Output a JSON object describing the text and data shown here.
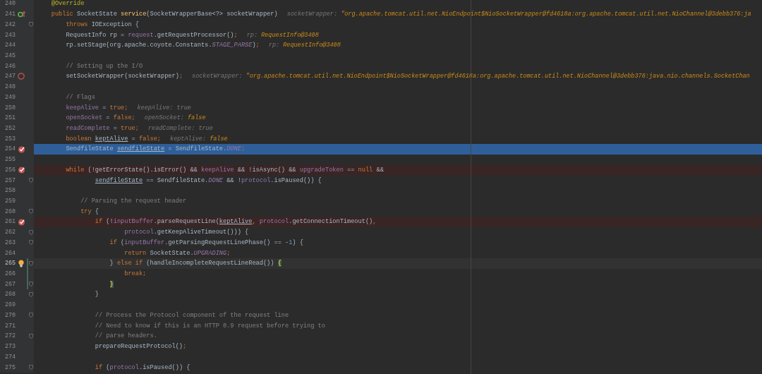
{
  "lines": [
    {
      "number": "240",
      "execution_point": false,
      "caret": false,
      "fold": false,
      "changed": false,
      "tokens": [
        {
          "text": "    @Override",
          "kind": "annotation"
        }
      ]
    },
    {
      "number": "241",
      "execution_point": false,
      "caret": false,
      "fold": false,
      "changed": false,
      "kind": "override",
      "tokens": [
        {
          "text": "    public",
          "kind": "keyword"
        },
        {
          "text": " SocketState ",
          "kind": "plain"
        },
        {
          "text": "service",
          "kind": "method"
        },
        {
          "text": "(SocketWrapperBase<?> socketWrapper)",
          "kind": "plain"
        }
      ],
      "hint": {
        "label": "socketWrapper: ",
        "value": "\"org.apache.tomcat.util.net.NioEndpoint$NioSocketWrapper@fd4618a:org.apache.tomcat.util.net.NioChannel@3debb376:ja",
        "kind": "emphasis"
      }
    },
    {
      "number": "242",
      "execution_point": false,
      "caret": false,
      "fold": true,
      "changed": false,
      "tokens": [
        {
          "text": "        throws",
          "kind": "keyword"
        },
        {
          "text": " IOException {",
          "kind": "plain"
        }
      ]
    },
    {
      "number": "243",
      "execution_point": false,
      "caret": false,
      "fold": false,
      "changed": false,
      "tokens": [
        {
          "text": "        RequestInfo rp = ",
          "kind": "plain"
        },
        {
          "text": "request",
          "kind": "field"
        },
        {
          "text": ".getRequestProcessor()",
          "kind": "plain"
        },
        {
          "text": ";",
          "kind": "keyword"
        }
      ],
      "hint": {
        "label": "rp: ",
        "value": "RequestInfo@3408",
        "kind": "emphasis"
      }
    },
    {
      "number": "244",
      "execution_point": false,
      "caret": false,
      "fold": false,
      "changed": false,
      "tokens": [
        {
          "text": "        rp.setStage(org.apache.coyote.Constants.",
          "kind": "plain"
        },
        {
          "text": "STAGE_PARSE",
          "kind": "static"
        },
        {
          "text": ")",
          "kind": "plain"
        },
        {
          "text": ";",
          "kind": "keyword"
        }
      ],
      "hint": {
        "label": "rp: ",
        "value": "RequestInfo@3408",
        "kind": "emphasis"
      }
    },
    {
      "number": "245",
      "execution_point": false,
      "caret": false,
      "fold": false,
      "changed": false
    },
    {
      "number": "246",
      "execution_point": false,
      "caret": false,
      "fold": false,
      "changed": false,
      "tokens": [
        {
          "text": "        // Setting up the I/O",
          "kind": "comment"
        }
      ]
    },
    {
      "number": "247",
      "execution_point": false,
      "caret": false,
      "fold": false,
      "changed": false,
      "kind": "disabled-breakpoint",
      "tokens": [
        {
          "text": "        setSocketWrapper(socketWrapper)",
          "kind": "plain"
        },
        {
          "text": ";",
          "kind": "keyword"
        }
      ],
      "hint": {
        "label": "socketWrapper: ",
        "value": "\"org.apache.tomcat.util.net.NioEndpoint$NioSocketWrapper@fd4618a:org.apache.tomcat.util.net.NioChannel@3debb376:java.nio.channels.SocketChan",
        "kind": "emphasis"
      }
    },
    {
      "number": "248",
      "execution_point": false,
      "caret": false,
      "fold": false,
      "changed": false
    },
    {
      "number": "249",
      "execution_point": false,
      "caret": false,
      "fold": false,
      "changed": false,
      "tokens": [
        {
          "text": "        // Flags",
          "kind": "comment"
        }
      ]
    },
    {
      "number": "250",
      "execution_point": false,
      "caret": false,
      "fold": false,
      "changed": false,
      "tokens": [
        {
          "text": "        keepAlive",
          "kind": "field"
        },
        {
          "text": " = ",
          "kind": "plain"
        },
        {
          "text": "true;",
          "kind": "keyword"
        }
      ],
      "hint": {
        "label": "keepAlive: ",
        "value": "true",
        "kind": "plain"
      }
    },
    {
      "number": "251",
      "execution_point": false,
      "caret": false,
      "fold": false,
      "changed": false,
      "tokens": [
        {
          "text": "        openSocket",
          "kind": "field"
        },
        {
          "text": " = ",
          "kind": "plain"
        },
        {
          "text": "false;",
          "kind": "keyword"
        }
      ],
      "hint": {
        "label": "openSocket: ",
        "value": "false",
        "kind": "emphasis"
      }
    },
    {
      "number": "252",
      "execution_point": false,
      "caret": false,
      "fold": false,
      "changed": false,
      "tokens": [
        {
          "text": "        readComplete",
          "kind": "field"
        },
        {
          "text": " = ",
          "kind": "plain"
        },
        {
          "text": "true;",
          "kind": "keyword"
        }
      ],
      "hint": {
        "label": "readComplete: ",
        "value": "true",
        "kind": "plain"
      }
    },
    {
      "number": "253",
      "execution_point": false,
      "caret": false,
      "fold": false,
      "changed": false,
      "tokens": [
        {
          "text": "        boolean ",
          "kind": "keyword"
        },
        {
          "text": "keptAlive",
          "kind": "underlined"
        },
        {
          "text": " = ",
          "kind": "plain"
        },
        {
          "text": "false;",
          "kind": "keyword"
        }
      ],
      "hint": {
        "label": "keptAlive: ",
        "value": "false",
        "kind": "emphasis"
      }
    },
    {
      "number": "254",
      "execution_point": true,
      "caret": false,
      "fold": false,
      "changed": false,
      "kind": "breakpoint",
      "tokens": [
        {
          "text": "        SendfileState ",
          "kind": "plain"
        },
        {
          "text": "sendfileState",
          "kind": "underlined"
        },
        {
          "text": " = SendfileState.",
          "kind": "plain"
        },
        {
          "text": "DONE",
          "kind": "static"
        },
        {
          "text": ";",
          "kind": "keyword"
        }
      ]
    },
    {
      "number": "255",
      "execution_point": false,
      "caret": false,
      "fold": false,
      "changed": false
    },
    {
      "number": "256",
      "execution_point": false,
      "caret": false,
      "fold": false,
      "changed": false,
      "kind": "breakpoint",
      "tokens": [
        {
          "text": "        while",
          "kind": "keyword"
        },
        {
          "text": " (!getErrorState().isError() && ",
          "kind": "plain"
        },
        {
          "text": "keepAlive",
          "kind": "field"
        },
        {
          "text": " && !isAsync() && ",
          "kind": "plain"
        },
        {
          "text": "upgradeToken",
          "kind": "field"
        },
        {
          "text": " == ",
          "kind": "plain"
        },
        {
          "text": "null",
          "kind": "keyword"
        },
        {
          "text": " &&",
          "kind": "plain"
        }
      ]
    },
    {
      "number": "257",
      "execution_point": false,
      "caret": false,
      "fold": true,
      "changed": false,
      "tokens": [
        {
          "text": "                sendfileState",
          "kind": "underlined"
        },
        {
          "text": " == SendfileState.",
          "kind": "plain"
        },
        {
          "text": "DONE",
          "kind": "static"
        },
        {
          "text": " && !",
          "kind": "plain"
        },
        {
          "text": "protocol",
          "kind": "field"
        },
        {
          "text": ".isPaused()) {",
          "kind": "plain"
        }
      ]
    },
    {
      "number": "258",
      "execution_point": false,
      "caret": false,
      "fold": false,
      "changed": false
    },
    {
      "number": "259",
      "execution_point": false,
      "caret": false,
      "fold": false,
      "changed": false,
      "tokens": [
        {
          "text": "            // Parsing the request header",
          "kind": "comment"
        }
      ]
    },
    {
      "number": "260",
      "execution_point": false,
      "caret": false,
      "fold": true,
      "changed": false,
      "tokens": [
        {
          "text": "            try",
          "kind": "keyword"
        },
        {
          "text": " {",
          "kind": "plain"
        }
      ]
    },
    {
      "number": "261",
      "execution_point": false,
      "caret": false,
      "fold": false,
      "changed": false,
      "kind": "breakpoint",
      "tokens": [
        {
          "text": "                if",
          "kind": "keyword"
        },
        {
          "text": " (!",
          "kind": "plain"
        },
        {
          "text": "inputBuffer",
          "kind": "field"
        },
        {
          "text": ".parseRequestLine(",
          "kind": "plain"
        },
        {
          "text": "keptAlive",
          "kind": "underlined"
        },
        {
          "text": ", ",
          "kind": "keyword"
        },
        {
          "text": "protocol",
          "kind": "field"
        },
        {
          "text": ".getConnectionTimeout()",
          "kind": "plain"
        },
        {
          "text": ",",
          "kind": "keyword"
        }
      ]
    },
    {
      "number": "262",
      "execution_point": false,
      "caret": false,
      "fold": true,
      "changed": false,
      "tokens": [
        {
          "text": "                        protocol",
          "kind": "field"
        },
        {
          "text": ".getKeepAliveTimeout())) {",
          "kind": "plain"
        }
      ]
    },
    {
      "number": "263",
      "execution_point": false,
      "caret": false,
      "fold": true,
      "changed": false,
      "tokens": [
        {
          "text": "                    if",
          "kind": "keyword"
        },
        {
          "text": " (",
          "kind": "plain"
        },
        {
          "text": "inputBuffer",
          "kind": "field"
        },
        {
          "text": ".getParsingRequestLinePhase() == -",
          "kind": "plain"
        },
        {
          "text": "1",
          "kind": "number"
        },
        {
          "text": ") {",
          "kind": "plain"
        }
      ]
    },
    {
      "number": "264",
      "execution_point": false,
      "caret": false,
      "fold": false,
      "changed": false,
      "tokens": [
        {
          "text": "                        return",
          "kind": "keyword"
        },
        {
          "text": " SocketState.",
          "kind": "plain"
        },
        {
          "text": "UPGRADING",
          "kind": "static"
        },
        {
          "text": ";",
          "kind": "keyword"
        }
      ]
    },
    {
      "number": "265",
      "execution_point": false,
      "caret": true,
      "fold": true,
      "changed": true,
      "kind": "intention",
      "tokens": [
        {
          "text": "                    } ",
          "kind": "plain"
        },
        {
          "text": "else if",
          "kind": "keyword"
        },
        {
          "text": " (handleIncompleteRequestLineRead()) ",
          "kind": "plain"
        },
        {
          "text": "{",
          "kind": "brace-match"
        }
      ]
    },
    {
      "number": "266",
      "execution_point": false,
      "caret": false,
      "fold": false,
      "changed": true,
      "tokens": [
        {
          "text": "                        break;",
          "kind": "keyword"
        }
      ]
    },
    {
      "number": "267",
      "execution_point": false,
      "caret": false,
      "fold": true,
      "changed": true,
      "tokens": [
        {
          "text": "                    }",
          "kind": "brace-match"
        }
      ]
    },
    {
      "number": "268",
      "execution_point": false,
      "caret": false,
      "fold": true,
      "changed": false,
      "tokens": [
        {
          "text": "                }",
          "kind": "plain"
        }
      ]
    },
    {
      "number": "269",
      "execution_point": false,
      "caret": false,
      "fold": false,
      "changed": false
    },
    {
      "number": "270",
      "execution_point": false,
      "caret": false,
      "fold": true,
      "changed": false,
      "tokens": [
        {
          "text": "                // Process the Protocol component of the request line",
          "kind": "comment"
        }
      ]
    },
    {
      "number": "271",
      "execution_point": false,
      "caret": false,
      "fold": false,
      "changed": false,
      "tokens": [
        {
          "text": "                // Need to know if this is an HTTP 0.9 request before trying to",
          "kind": "comment"
        }
      ]
    },
    {
      "number": "272",
      "execution_point": false,
      "caret": false,
      "fold": true,
      "changed": false,
      "tokens": [
        {
          "text": "                // parse headers.",
          "kind": "comment"
        }
      ]
    },
    {
      "number": "273",
      "execution_point": false,
      "caret": false,
      "fold": false,
      "changed": false,
      "tokens": [
        {
          "text": "                prepareRequestProtocol()",
          "kind": "plain"
        },
        {
          "text": ";",
          "kind": "keyword"
        }
      ]
    },
    {
      "number": "274",
      "execution_point": false,
      "caret": false,
      "fold": false,
      "changed": false
    },
    {
      "number": "275",
      "execution_point": false,
      "caret": false,
      "fold": true,
      "changed": false,
      "tokens": [
        {
          "text": "                if",
          "kind": "keyword"
        },
        {
          "text": " (",
          "kind": "plain"
        },
        {
          "text": "protocol",
          "kind": "field"
        },
        {
          "text": ".isPaused()) {",
          "kind": "plain"
        }
      ]
    }
  ]
}
